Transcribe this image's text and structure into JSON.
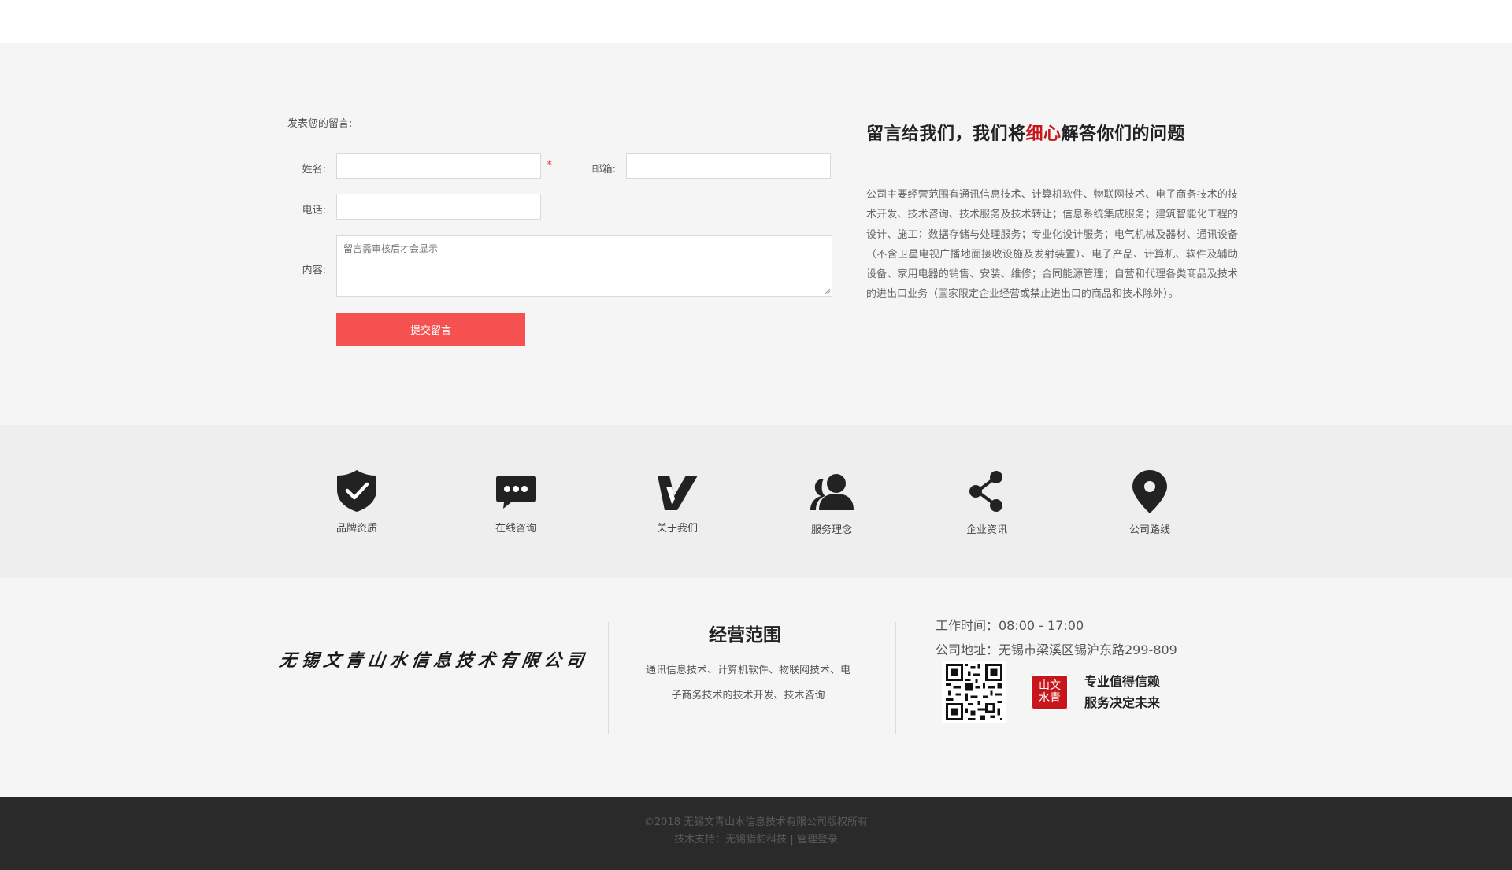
{
  "form": {
    "heading": "发表您的留言:",
    "name_label": "姓名:",
    "name_value": "",
    "required_mark": "*",
    "email_label": "邮箱:",
    "email_value": "",
    "phone_label": "电话:",
    "phone_value": "",
    "content_label": "内容:",
    "content_placeholder": "留言需审核后才会显示",
    "submit_label": "提交留言"
  },
  "info": {
    "title_prefix": "留言给我们，我们将",
    "title_highlight": "细心",
    "title_suffix": "解答你们的问题",
    "highlight_color": "#c8161d",
    "body": "公司主要经营范围有通讯信息技术、计算机软件、物联网技术、电子商务技术的技术开发、技术咨询、技术服务及技术转让；信息系统集成服务；建筑智能化工程的设计、施工；数据存储与处理服务；专业化设计服务；电气机械及器材、通讯设备（不含卫星电视广播地面接收设施及发射装置）、电子产品、计算机、软件及辅助设备、家用电器的销售、安装、维修；合同能源管理；自营和代理各类商品及技术的进出口业务（国家限定企业经营或禁止进出口的商品和技术除外）。"
  },
  "icon_bar": {
    "items": [
      {
        "icon": "shield-check-icon",
        "label": "品牌资质"
      },
      {
        "icon": "chat-bubble-icon",
        "label": "在线咨询"
      },
      {
        "icon": "v-logo-icon",
        "label": "关于我们"
      },
      {
        "icon": "user-group-icon",
        "label": "服务理念"
      },
      {
        "icon": "share-icon",
        "label": "企业资讯"
      },
      {
        "icon": "map-pin-icon",
        "label": "公司路线"
      }
    ]
  },
  "footer": {
    "company_logo_text": "无锡文青山水信息技术有限公司",
    "scope_title": "经营范围",
    "scope_body": "通讯信息技术、计算机软件、物联网技术、电子商务技术的技术开发、技术咨询",
    "work_hours": "工作时间：08:00 - 17:00",
    "address": "公司地址：无锡市梁溪区锡沪东路299-809",
    "seal_text": "山文水青",
    "slogan_1": "专业值得信赖",
    "slogan_2": "服务决定未来",
    "brand_color": "#c8161d"
  },
  "bottom": {
    "copyright": "©2018 无锡文青山水信息技术有限公司版权所有",
    "support_prefix": "技术支持：",
    "support_link": "无锡猎豹科技",
    "separator": "|",
    "admin_link": "管理登录"
  },
  "colors": {
    "accent_button": "#f65151",
    "footer_dark": "#2a2a2a"
  }
}
